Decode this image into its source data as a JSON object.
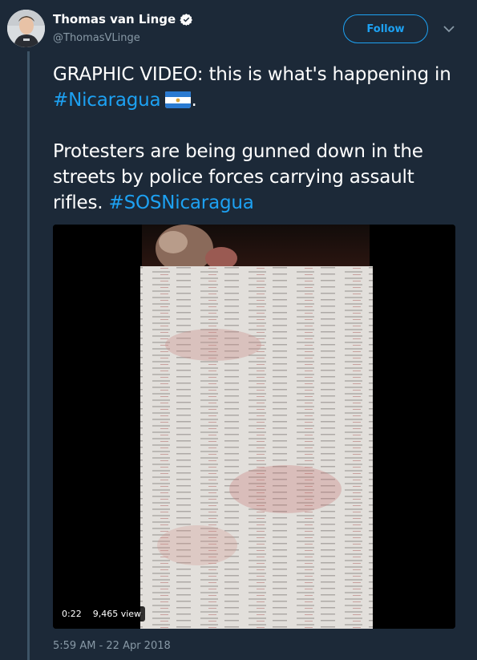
{
  "tweet": {
    "author_name": "Thomas van Linge",
    "handle": "@ThomasVLinge",
    "follow_label": "Follow",
    "text_line1_before": "GRAPHIC VIDEO: this is what's happening in ",
    "hashtag1": "#Nicaragua",
    "text_line1_after": ".",
    "text_p2_before": "Protesters are being gunned down in the streets by police forces carrying assault rifles. ",
    "hashtag2": "#SOSNicaragua",
    "timestamp": "5:59 AM - 22 Apr 2018"
  },
  "video": {
    "duration": "0:22",
    "views": "9,465 view"
  },
  "icons": {
    "verified": "verified-badge-icon",
    "caret": "chevron-down-icon",
    "flag": "nicaragua-flag-icon"
  },
  "colors": {
    "background": "#1c2938",
    "accent": "#1da1f2",
    "secondary_text": "#8899a6",
    "thread_line": "#3d5466"
  }
}
